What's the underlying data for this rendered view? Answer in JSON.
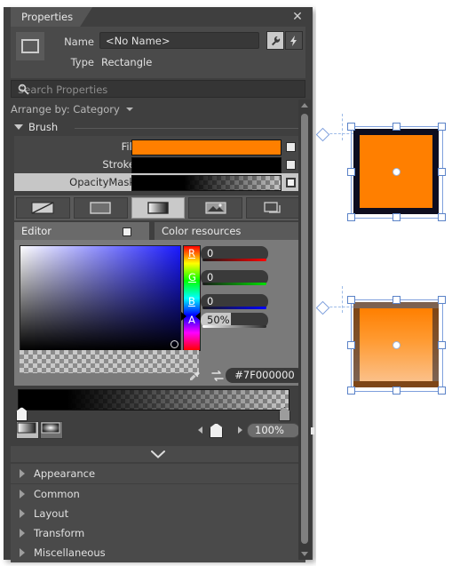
{
  "panel": {
    "tab_label": "Properties",
    "close_icon": "close-icon"
  },
  "header": {
    "name_label": "Name",
    "name_value": "<No Name>",
    "type_label": "Type",
    "type_value": "Rectangle",
    "type_icon": "rectangle-icon",
    "wrench_icon": "wrench-icon",
    "bolt_icon": "lightning-bolt-icon"
  },
  "search": {
    "placeholder": "Search Properties",
    "icon": "search-icon"
  },
  "arrange": {
    "label": "Arrange by: Category"
  },
  "brush": {
    "group_title": "Brush",
    "rows": [
      {
        "label": "Fill",
        "swatch": "#FF7F00",
        "kind": "solid"
      },
      {
        "label": "Stroke",
        "swatch": "#000000",
        "kind": "solid"
      },
      {
        "label": "OpacityMask",
        "swatch": "#000000",
        "kind": "gradient-alpha"
      }
    ],
    "brush_types": [
      {
        "name": "no-brush",
        "selected": false
      },
      {
        "name": "solid-color-brush",
        "selected": false
      },
      {
        "name": "gradient-brush",
        "selected": true
      },
      {
        "name": "tile-brush",
        "selected": false
      },
      {
        "name": "brush-resource",
        "selected": false
      }
    ]
  },
  "editor": {
    "tab_editor": "Editor",
    "tab_color_resources": "Color resources",
    "channels": [
      {
        "key": "R",
        "value": "0"
      },
      {
        "key": "G",
        "value": "0"
      },
      {
        "key": "B",
        "value": "0"
      },
      {
        "key": "A",
        "value": "50%"
      }
    ],
    "hex_value": "#7F000000",
    "eyedropper_icon": "eyedropper-icon",
    "swap_icon": "swap-colors-icon"
  },
  "gradient": {
    "linear_icon": "linear-gradient-icon",
    "radial_icon": "radial-gradient-icon",
    "reverse_icon": "reverse-gradient-stops-icon",
    "linear_selected": true,
    "offset_value": "100%",
    "prev_stop_icon": "previous-stop-icon",
    "next_stop_icon": "next-stop-icon"
  },
  "categories": [
    {
      "label": "Appearance"
    },
    {
      "label": "Common"
    },
    {
      "label": "Layout"
    },
    {
      "label": "Transform"
    },
    {
      "label": "Miscellaneous"
    }
  ],
  "canvas": {
    "top_shape": {
      "name": "rectangle-solid",
      "fill": "#FF7F00",
      "stroke": "#0D0D1F"
    },
    "bottom_shape": {
      "name": "rectangle-masked",
      "fill": "#FF7F00",
      "stroke": "#141628"
    },
    "arrow": {
      "name": "comparison-arrow",
      "color": "#D81E1E"
    }
  },
  "colors": {
    "panel_bg": "#3F3F3F",
    "accent_orange": "#FF7F00",
    "selection_blue": "#7FA0DD"
  }
}
